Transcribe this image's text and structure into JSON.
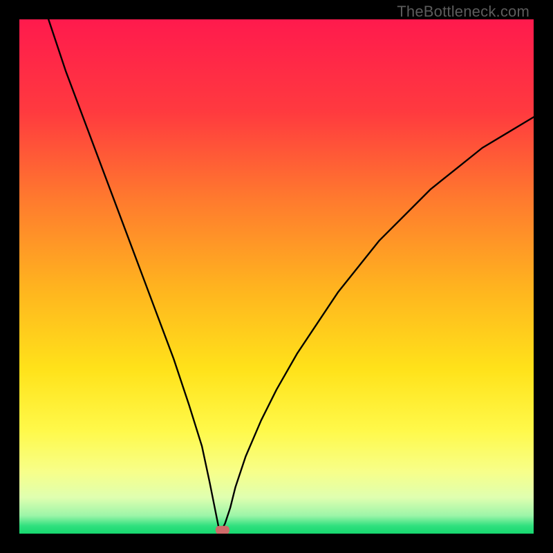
{
  "watermark": "TheBottleneck.com",
  "chart_data": {
    "type": "line",
    "title": "",
    "xlabel": "",
    "ylabel": "",
    "xlim": [
      0,
      100
    ],
    "ylim": [
      0,
      100
    ],
    "curve_min_x": 39,
    "curve_min_y": 0,
    "marker": {
      "x": 39.5,
      "y": 0.7,
      "color": "#cf6b6a"
    },
    "series": [
      {
        "name": "bottleneck-curve",
        "x": [
          0,
          3,
          6,
          9,
          12,
          15,
          18,
          21,
          24,
          27,
          30,
          33,
          35.5,
          37,
          38,
          39,
          40,
          41,
          42,
          44,
          47,
          50,
          54,
          58,
          62,
          66,
          70,
          75,
          80,
          85,
          90,
          95,
          100
        ],
        "values": [
          118,
          108,
          99,
          90,
          82,
          74,
          66,
          58,
          50,
          42,
          34,
          25,
          17,
          10,
          5,
          0,
          2,
          5,
          9,
          15,
          22,
          28,
          35,
          41,
          47,
          52,
          57,
          62,
          67,
          71,
          75,
          78,
          81
        ]
      }
    ],
    "gradient_stops": [
      {
        "offset": 0.0,
        "color": "#ff1a4d"
      },
      {
        "offset": 0.18,
        "color": "#ff3a3f"
      },
      {
        "offset": 0.35,
        "color": "#ff7a2e"
      },
      {
        "offset": 0.52,
        "color": "#ffb31f"
      },
      {
        "offset": 0.68,
        "color": "#ffe21a"
      },
      {
        "offset": 0.8,
        "color": "#fff94a"
      },
      {
        "offset": 0.88,
        "color": "#f7ff8a"
      },
      {
        "offset": 0.93,
        "color": "#dfffb0"
      },
      {
        "offset": 0.965,
        "color": "#9cf5a8"
      },
      {
        "offset": 0.985,
        "color": "#2fe07e"
      },
      {
        "offset": 1.0,
        "color": "#17d86f"
      }
    ]
  }
}
